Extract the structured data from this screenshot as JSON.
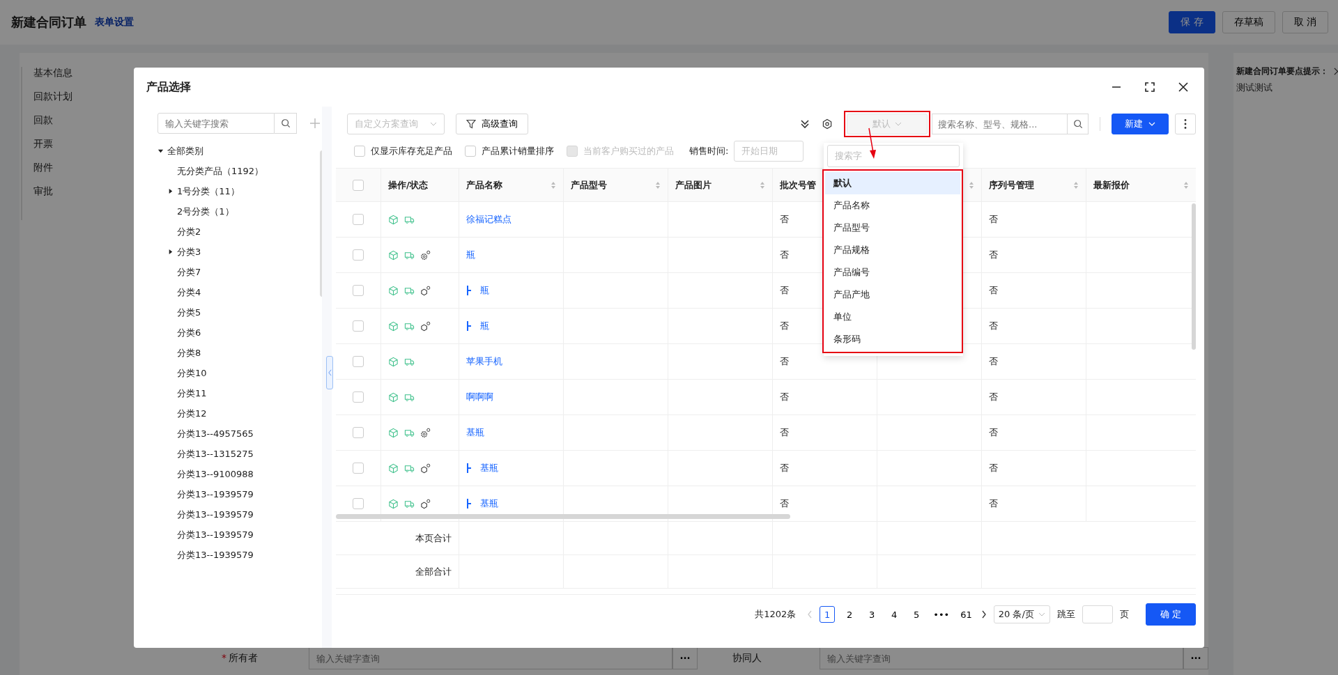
{
  "header": {
    "title": "新建合同订单",
    "link": "表单设置",
    "buttons": [
      {
        "label": "保 存",
        "kind": "primary"
      },
      {
        "label": "存草稿",
        "kind": "default"
      },
      {
        "label": "取 消",
        "kind": "default"
      }
    ]
  },
  "side_nav": {
    "items": [
      "基本信息",
      "回款计划",
      "回款",
      "开票",
      "附件",
      "审批"
    ]
  },
  "tip": {
    "title": "新建合同订单要点提示：",
    "text": "测试测试"
  },
  "bottom_form": [
    {
      "mark": "*",
      "label": "所有者",
      "placeholder": "输入关键字查询",
      "button": "···"
    },
    {
      "label": "协同人",
      "placeholder": "输入关键字查询",
      "button": "···"
    }
  ],
  "dialog": {
    "title": "产品选择",
    "tree": {
      "search_placeholder": "输入关键字搜索",
      "nodes": [
        {
          "label": "全部类别",
          "expandable": true,
          "expanded": true,
          "children": [
            {
              "label": "无分类产品（1192）",
              "expandable": false
            },
            {
              "label": "1号分类（11）",
              "expandable": true,
              "expanded": false
            },
            {
              "label": "2号分类（1）",
              "expandable": false
            },
            {
              "label": "分类2",
              "expandable": false
            },
            {
              "label": "分类3",
              "expandable": true,
              "expanded": false
            },
            {
              "label": "分类7",
              "expandable": false
            },
            {
              "label": "分类4",
              "expandable": false
            },
            {
              "label": "分类5",
              "expandable": false
            },
            {
              "label": "分类6",
              "expandable": false
            },
            {
              "label": "分类8",
              "expandable": false
            },
            {
              "label": "分类10",
              "expandable": false
            },
            {
              "label": "分类11",
              "expandable": false
            },
            {
              "label": "分类12",
              "expandable": false
            },
            {
              "label": "分类13--4957565",
              "expandable": false
            },
            {
              "label": "分类13--1315275",
              "expandable": false
            },
            {
              "label": "分类13--9100988",
              "expandable": false
            },
            {
              "label": "分类13--1939579",
              "expandable": false
            },
            {
              "label": "分类13--1939579",
              "expandable": false
            },
            {
              "label": "分类13--1939579",
              "expandable": false
            },
            {
              "label": "分类13--1939579",
              "expandable": false
            }
          ]
        }
      ]
    },
    "toolbar": {
      "scheme_placeholder": "自定义方案查询",
      "advanced": "高级查询",
      "field_select": "默认",
      "search_placeholder": "搜索名称、型号、规格...",
      "new_button": "新建"
    },
    "filters": [
      {
        "label": "仅显示库存充足产品",
        "checked": false,
        "disabled": false
      },
      {
        "label": "产品累计销量排序",
        "checked": false,
        "disabled": false
      },
      {
        "label": "当前客户购买过的产品",
        "checked": false,
        "disabled": true
      }
    ],
    "sales_time": {
      "label": "销售时间:",
      "placeholder": "开始日期"
    },
    "field_dropdown": {
      "search_placeholder": "搜索字",
      "options": [
        {
          "label": "默认",
          "selected": true
        },
        {
          "label": "产品名称",
          "selected": false
        },
        {
          "label": "产品型号",
          "selected": false
        },
        {
          "label": "产品规格",
          "selected": false
        },
        {
          "label": "产品编号",
          "selected": false
        },
        {
          "label": "产品产地",
          "selected": false
        },
        {
          "label": "单位",
          "selected": false
        },
        {
          "label": "条形码",
          "selected": false
        }
      ]
    },
    "table": {
      "columns": [
        {
          "label": "操作/状态",
          "sortable": false
        },
        {
          "label": "产品名称",
          "sortable": true
        },
        {
          "label": "产品型号",
          "sortable": true
        },
        {
          "label": "产品图片",
          "sortable": true
        },
        {
          "label": "批次号管"
        },
        {
          "sortable": true
        },
        {
          "label": "序列号管理",
          "sortable": true
        },
        {
          "label": "最新报价",
          "sortable": true
        }
      ],
      "select_all_checked": false,
      "rows": [
        {
          "checked": false,
          "icons": [
            {
              "kind": "box"
            },
            {
              "kind": "truck"
            }
          ],
          "child": false,
          "name": "徐福记糕点",
          "batch": "否",
          "serial": "否"
        },
        {
          "checked": false,
          "icons": [
            {
              "kind": "box"
            },
            {
              "kind": "truck"
            },
            {
              "kind": "gear"
            }
          ],
          "child": false,
          "name": "瓶",
          "batch": "否",
          "serial": "否"
        },
        {
          "checked": false,
          "icons": [
            {
              "kind": "box"
            },
            {
              "kind": "truck"
            },
            {
              "kind": "nodes"
            }
          ],
          "child": true,
          "name": "瓶",
          "batch": "否",
          "serial": "否"
        },
        {
          "checked": false,
          "icons": [
            {
              "kind": "box"
            },
            {
              "kind": "truck"
            },
            {
              "kind": "nodes"
            }
          ],
          "child": true,
          "name": "瓶",
          "batch": "否",
          "serial": "否"
        },
        {
          "checked": false,
          "icons": [
            {
              "kind": "box"
            },
            {
              "kind": "truck"
            }
          ],
          "child": false,
          "name": "苹果手机",
          "batch": "否",
          "serial": "否"
        },
        {
          "checked": false,
          "icons": [
            {
              "kind": "box"
            },
            {
              "kind": "truck"
            }
          ],
          "child": false,
          "name": "啊啊啊",
          "batch": "否",
          "serial": "否"
        },
        {
          "checked": false,
          "icons": [
            {
              "kind": "box"
            },
            {
              "kind": "truck"
            },
            {
              "kind": "gear"
            }
          ],
          "child": false,
          "name": "基瓶",
          "batch": "否",
          "serial": "否"
        },
        {
          "checked": false,
          "icons": [
            {
              "kind": "box"
            },
            {
              "kind": "truck"
            },
            {
              "kind": "nodes"
            }
          ],
          "child": true,
          "name": "基瓶",
          "batch": "否",
          "serial": "否"
        },
        {
          "checked": false,
          "icons": [
            {
              "kind": "box"
            },
            {
              "kind": "truck"
            },
            {
              "kind": "nodes"
            }
          ],
          "child": true,
          "name": "基瓶",
          "batch": "否",
          "serial": "否"
        }
      ],
      "summary_rows": [
        "本页合计",
        "全部合计"
      ]
    },
    "pager": {
      "total": "共1202条",
      "pages": [
        {
          "label": "1",
          "selected": true
        },
        {
          "label": "2",
          "selected": false
        },
        {
          "label": "3",
          "selected": false
        },
        {
          "label": "4",
          "selected": false
        },
        {
          "label": "5",
          "selected": false
        },
        {
          "label": "•••",
          "selected": false
        },
        {
          "label": "61",
          "selected": false
        }
      ],
      "page_size": "20 条/页",
      "jump": "跳至",
      "page_unit": "页",
      "confirm": "确 定"
    }
  }
}
